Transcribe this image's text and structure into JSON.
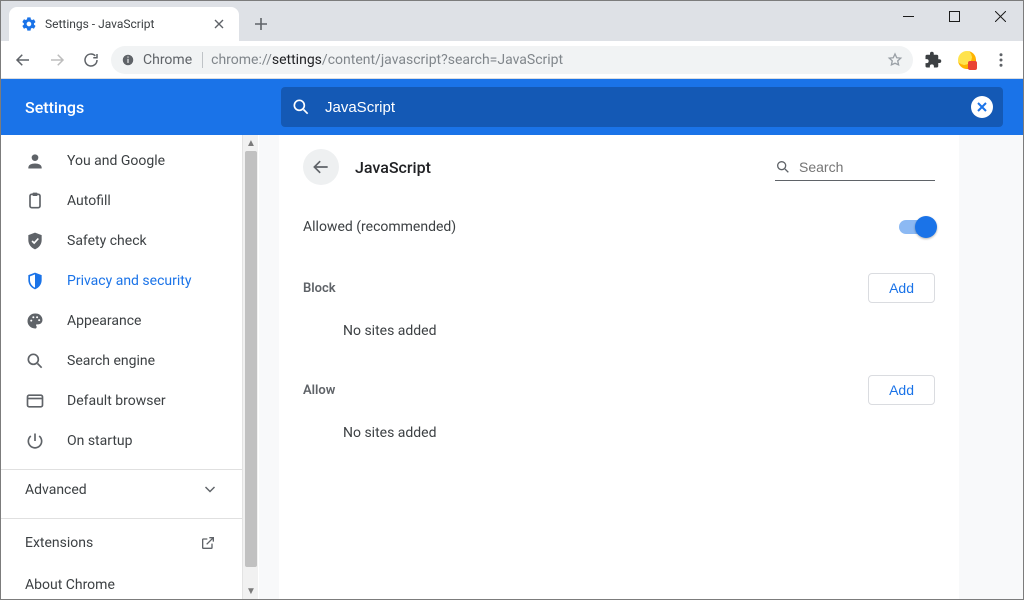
{
  "browser": {
    "tab_title": "Settings - JavaScript",
    "scheme_label": "Chrome",
    "url_pre": "chrome://",
    "url_bold": "settings",
    "url_post": "/content/javascript?search=JavaScript"
  },
  "header": {
    "title": "Settings",
    "search_value": "JavaScript"
  },
  "sidebar": {
    "items": [
      {
        "label": "You and Google"
      },
      {
        "label": "Autofill"
      },
      {
        "label": "Safety check"
      },
      {
        "label": "Privacy and security"
      },
      {
        "label": "Appearance"
      },
      {
        "label": "Search engine"
      },
      {
        "label": "Default browser"
      },
      {
        "label": "On startup"
      }
    ],
    "advanced_label": "Advanced",
    "extensions_label": "Extensions",
    "about_label": "About Chrome"
  },
  "page": {
    "title": "JavaScript",
    "search_placeholder": "Search",
    "allowed_label": "Allowed (recommended)",
    "allowed_value": true,
    "sections": {
      "block": {
        "title": "Block",
        "add_label": "Add",
        "empty": "No sites added"
      },
      "allow": {
        "title": "Allow",
        "add_label": "Add",
        "empty": "No sites added"
      }
    }
  }
}
